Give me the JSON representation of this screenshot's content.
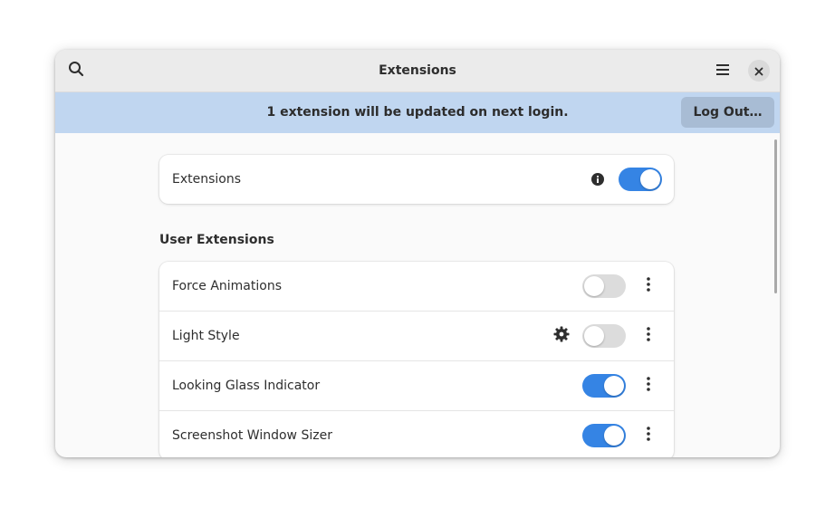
{
  "window": {
    "title": "Extensions"
  },
  "headerbar": {
    "search_icon": "search-icon",
    "menu_icon": "hamburger-menu-icon",
    "close_icon": "close-icon"
  },
  "infobar": {
    "message": "1 extension will be updated on next login.",
    "logout_label": "Log Out…"
  },
  "master_toggle": {
    "label": "Extensions",
    "info_icon": "info-icon",
    "enabled": true
  },
  "user_extensions": {
    "heading": "User Extensions",
    "items": [
      {
        "label": "Force Animations",
        "enabled": false,
        "has_settings": false
      },
      {
        "label": "Light Style",
        "enabled": false,
        "has_settings": true
      },
      {
        "label": "Looking Glass Indicator",
        "enabled": true,
        "has_settings": false
      },
      {
        "label": "Screenshot Window Sizer",
        "enabled": true,
        "has_settings": false
      }
    ]
  },
  "colors": {
    "accent": "#3584e4",
    "infobar_bg": "#c0d6f0",
    "headerbar_bg": "#ebebeb"
  }
}
